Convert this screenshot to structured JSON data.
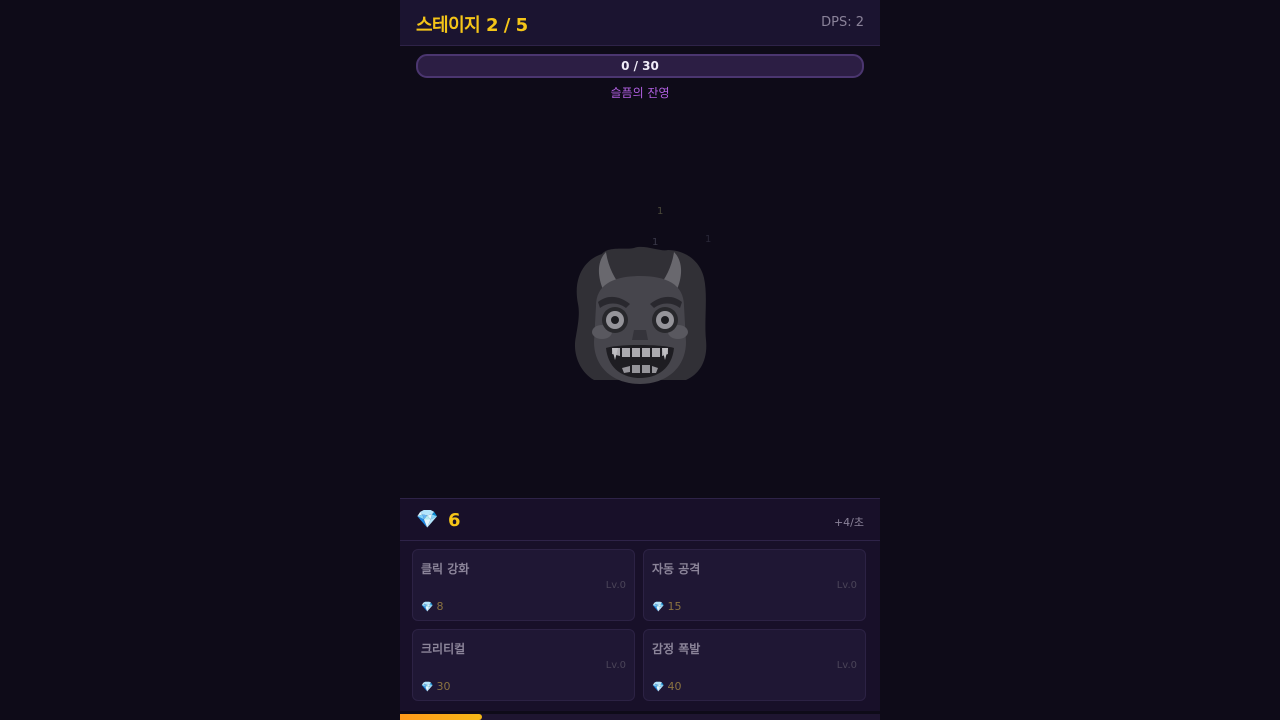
{
  "header": {
    "stage_title": "스테이지 2 / 5",
    "dps": "DPS: 2"
  },
  "enemy": {
    "hp_text": "0 / 30",
    "hp_fraction": 0,
    "name": "슬픔의 잔영",
    "icon": "ogre-face-icon",
    "hit_numbers": [
      "1",
      "1",
      "1"
    ]
  },
  "currency": {
    "icon": "gem-icon",
    "amount": "6",
    "rate": "+4/초"
  },
  "upgrades": [
    {
      "name": "클릭 강화",
      "level": "Lv.0",
      "cost": "8"
    },
    {
      "name": "자동 공격",
      "level": "Lv.0",
      "cost": "15"
    },
    {
      "name": "크리티컬",
      "level": "Lv.0",
      "cost": "30"
    },
    {
      "name": "감정 폭발",
      "level": "Lv.0",
      "cost": "40"
    }
  ],
  "stage_progress": 0.17,
  "colors": {
    "accent_gold": "#f5c518",
    "enemy_name": "#b05fe0",
    "background": "#0e0b18",
    "panel": "#181029",
    "progress": "#ff9a1a"
  }
}
